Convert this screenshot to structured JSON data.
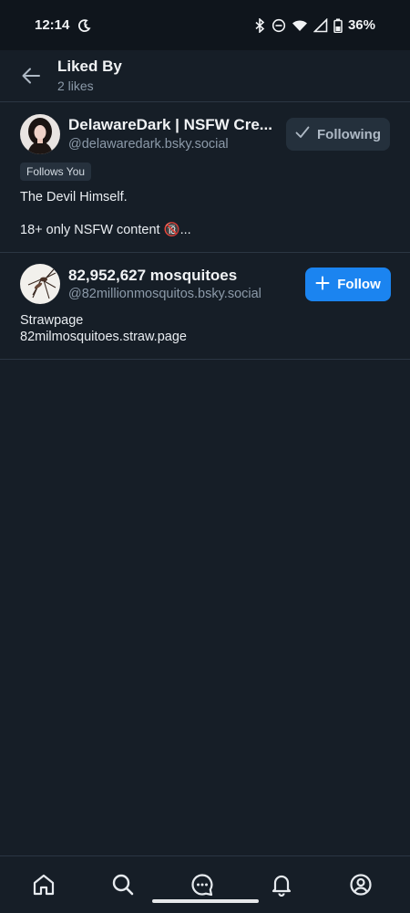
{
  "status_bar": {
    "time": "12:14",
    "battery": "36%"
  },
  "header": {
    "title": "Liked By",
    "subtitle": "2 likes"
  },
  "users": [
    {
      "display_name": "DelawareDark | NSFW Cre...",
      "handle": "@delawaredark.bsky.social",
      "button_label": "Following",
      "badge": "Follows You",
      "description_line1": "The Devil Himself.",
      "description_line2": "18+ only NSFW content 🔞..."
    },
    {
      "display_name": "82,952,627 mosquitoes",
      "handle": "@82millionmosquitos.bsky.social",
      "button_label": "Follow",
      "description_line1": "Strawpage",
      "description_line2": "82milmosquitoes.straw.page"
    }
  ],
  "bottom_nav": [
    "home-icon",
    "search-icon",
    "chat-icon",
    "bell-icon",
    "profile-icon"
  ],
  "colors": {
    "background": "#161e27",
    "accent": "#1b84f0",
    "muted_text": "#8c9aa9"
  }
}
